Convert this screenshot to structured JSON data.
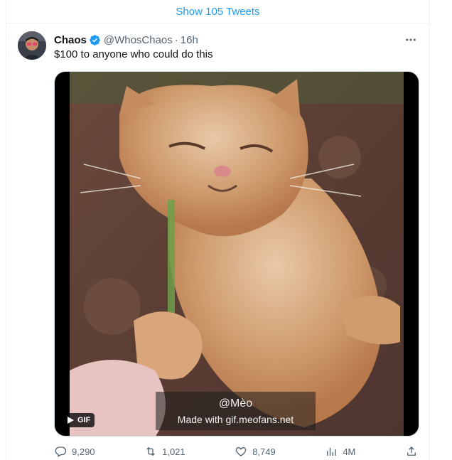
{
  "thread": {
    "show_more_label": "Show 105 Tweets"
  },
  "tweet": {
    "author_name": "Chaos",
    "handle": "@WhosChaos",
    "separator": "·",
    "time": "16h",
    "text": "$100 to anyone who could do this",
    "verified_icon": "verified-badge-icon",
    "more_icon": "more-icon"
  },
  "media": {
    "type_badge": "GIF",
    "watermark_line1": "@Mèo",
    "watermark_line2": "Made with gif.meofans.net"
  },
  "actions": {
    "replies": "9,290",
    "retweets": "1,021",
    "likes": "8,749",
    "views": "4M"
  },
  "colors": {
    "accent": "#1d9bf0",
    "muted_text": "#536471",
    "primary_text": "#0f1419"
  }
}
